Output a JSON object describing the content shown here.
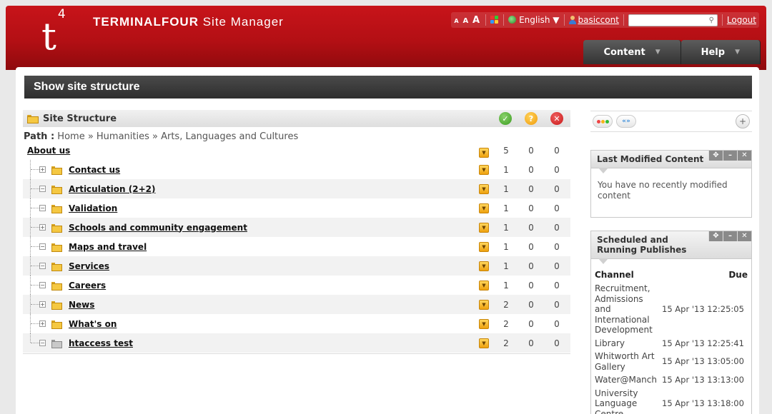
{
  "header": {
    "logo_letter": "t",
    "logo_sup": "4",
    "app_title_bold": "TERMINALFOUR",
    "app_title_rest": " Site Manager",
    "font_sizes": [
      "A",
      "A",
      "A"
    ],
    "language": "English",
    "username": "basiccont",
    "search_placeholder": "",
    "logout": "Logout"
  },
  "nav": {
    "tabs": [
      {
        "label": "Content"
      },
      {
        "label": "Help"
      }
    ]
  },
  "page": {
    "title": "Show site structure"
  },
  "site_structure": {
    "panel_title": "Site Structure",
    "path_label": "Path :",
    "path": "Home » Humanities » Arts, Languages and Cultures",
    "root": {
      "label": "About us",
      "c1": "5",
      "c2": "0",
      "c3": "0"
    },
    "items": [
      {
        "label": "Contact us",
        "expander": "+",
        "c1": "1",
        "c2": "0",
        "c3": "0"
      },
      {
        "label": "Articulation (2+2)",
        "expander": "",
        "c1": "1",
        "c2": "0",
        "c3": "0"
      },
      {
        "label": "Validation",
        "expander": "",
        "c1": "1",
        "c2": "0",
        "c3": "0"
      },
      {
        "label": "Schools and community engagement",
        "expander": "+",
        "c1": "1",
        "c2": "0",
        "c3": "0"
      },
      {
        "label": "Maps and travel",
        "expander": "",
        "c1": "1",
        "c2": "0",
        "c3": "0"
      },
      {
        "label": "Services",
        "expander": "",
        "c1": "1",
        "c2": "0",
        "c3": "0"
      },
      {
        "label": "Careers",
        "expander": "",
        "c1": "1",
        "c2": "0",
        "c3": "0"
      },
      {
        "label": "News",
        "expander": "+",
        "c1": "2",
        "c2": "0",
        "c3": "0"
      },
      {
        "label": "What's on",
        "expander": "+",
        "c1": "2",
        "c2": "0",
        "c3": "0"
      },
      {
        "label": "htaccess test",
        "expander": "",
        "c1": "2",
        "c2": "0",
        "c3": "0"
      }
    ]
  },
  "widgets": {
    "last_modified": {
      "title": "Last Modified Content",
      "message": "You have no recently modified content"
    },
    "scheduled": {
      "title": "Scheduled and Running Publishes",
      "col_channel": "Channel",
      "col_due": "Due",
      "rows": [
        {
          "channel": "Recruitment, Admissions and International Development",
          "due": "15 Apr '13 12:25:05"
        },
        {
          "channel": "Library",
          "due": "15 Apr '13 12:25:41"
        },
        {
          "channel": "Whitworth Art Gallery",
          "due": "15 Apr '13 13:05:00"
        },
        {
          "channel": "Water@Manchester",
          "due": "15 Apr '13 13:13:00"
        },
        {
          "channel": "University Language Centre",
          "due": "15 Apr '13 13:18:00"
        }
      ]
    }
  },
  "icons": {
    "widget_controls": [
      "move-icon",
      "minimize-icon",
      "close-icon"
    ]
  },
  "colors": {
    "brand_red": "#b30f14",
    "dark_bar": "#333333",
    "approved": "#3b9c20",
    "pending": "#f09a0a",
    "inactive": "#c81818"
  }
}
